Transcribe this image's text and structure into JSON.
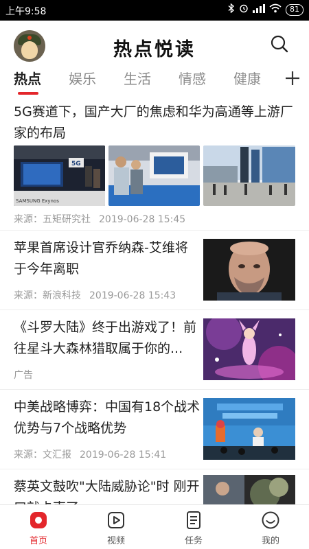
{
  "status_bar": {
    "time": "上午9:58",
    "battery": "81"
  },
  "app": {
    "logo_text": "热点悦读"
  },
  "tabs": [
    {
      "label": "热点",
      "active": true
    },
    {
      "label": "娱乐",
      "active": false
    },
    {
      "label": "生活",
      "active": false
    },
    {
      "label": "情感",
      "active": false
    },
    {
      "label": "健康",
      "active": false
    }
  ],
  "articles": [
    {
      "title": "5G赛道下，国产大厂的焦虑和华为高通等上游厂家的布局",
      "source": "来源：五矩研究社",
      "time": "2019-06-28 15:45",
      "image_caption": "SAMSUNG Exynos",
      "badge": "5G"
    },
    {
      "title": "苹果首席设计官乔纳森-艾维将于今年离职",
      "source": "来源：新浪科技",
      "time": "2019-06-28 15:43"
    },
    {
      "title": "《斗罗大陆》终于出游戏了！前往星斗大森林猎取属于你的...",
      "source": "广告",
      "time": ""
    },
    {
      "title": "中美战略博弈：中国有18个战术优势与7个战略优势",
      "source": "来源：文汇报",
      "time": "2019-06-28 15:41"
    },
    {
      "title": "蔡英文鼓吹\"大陆威胁论\"时 刚开口就卡壳了",
      "source": "",
      "time": ""
    }
  ],
  "bottom_nav": [
    {
      "label": "首页",
      "icon": "home-icon",
      "active": true
    },
    {
      "label": "视频",
      "icon": "video-icon",
      "active": false
    },
    {
      "label": "任务",
      "icon": "task-icon",
      "active": false
    },
    {
      "label": "我的",
      "icon": "profile-icon",
      "active": false
    }
  ],
  "colors": {
    "accent": "#e3262b",
    "text": "#222222",
    "muted": "#999999"
  }
}
